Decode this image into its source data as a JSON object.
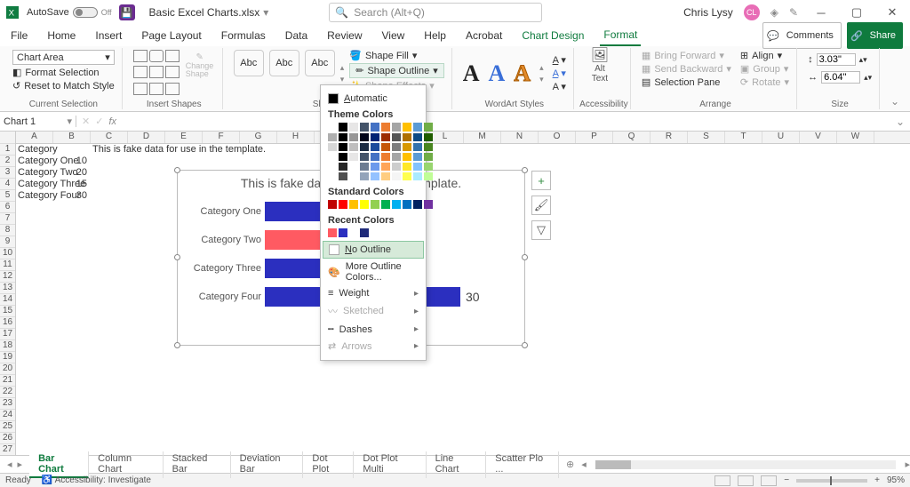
{
  "titlebar": {
    "autosave": "AutoSave",
    "autosave_state": "Off",
    "filename": "Basic Excel Charts.xlsx",
    "search_placeholder": "Search (Alt+Q)",
    "user": "Chris Lysy",
    "initials": "CL"
  },
  "menutabs": [
    "File",
    "Home",
    "Insert",
    "Page Layout",
    "Formulas",
    "Data",
    "Review",
    "View",
    "Help",
    "Acrobat",
    "Chart Design",
    "Format"
  ],
  "menu_active": "Format",
  "comments_btn": "Comments",
  "share_btn": "Share",
  "ribbon": {
    "current_selection": {
      "value": "Chart Area",
      "format_selection": "Format Selection",
      "reset": "Reset to Match Style",
      "label": "Current Selection"
    },
    "insert_shapes": {
      "change": "Change Shape",
      "label": "Insert Shapes"
    },
    "shape_styles": {
      "abc": "Abc",
      "fill": "Shape Fill",
      "outline": "Shape Outline",
      "effects": "Shape Effects",
      "label": "Shape Styles"
    },
    "wordart": {
      "label": "WordArt Styles"
    },
    "accessibility": {
      "alt": "Alt Text",
      "label": "Accessibility"
    },
    "arrange": {
      "bring": "Bring Forward",
      "send": "Send Backward",
      "selpane": "Selection Pane",
      "align": "Align",
      "group": "Group",
      "rotate": "Rotate",
      "label": "Arrange"
    },
    "size": {
      "h": "3.03\"",
      "w": "6.04\"",
      "label": "Size"
    }
  },
  "outline_dropdown": {
    "automatic": "Automatic",
    "theme": "Theme Colors",
    "standard": "Standard Colors",
    "recent": "Recent Colors",
    "no_outline": "No Outline",
    "more": "More Outline Colors...",
    "weight": "Weight",
    "sketched": "Sketched",
    "dashes": "Dashes",
    "arrows": "Arrows",
    "theme_row1": [
      "#ffffff",
      "#000000",
      "#e7e6e6",
      "#44546a",
      "#4472c4",
      "#ed7d31",
      "#a5a5a5",
      "#ffc000",
      "#5b9bd5",
      "#70ad47"
    ],
    "standard_row": [
      "#c00000",
      "#ff0000",
      "#ffc000",
      "#ffff00",
      "#92d050",
      "#00b050",
      "#00b0f0",
      "#0070c0",
      "#002060",
      "#7030a0"
    ],
    "recent_row": [
      "#ff5a62",
      "#2b2fbf",
      "#ffffff",
      "#1f2a79"
    ]
  },
  "namebox": "Chart 1",
  "columns": [
    "A",
    "B",
    "C",
    "D",
    "E",
    "F",
    "G",
    "H",
    "I",
    "J",
    "K",
    "L",
    "M",
    "N",
    "O",
    "P",
    "Q",
    "R",
    "S",
    "T",
    "U",
    "V",
    "W"
  ],
  "cells": {
    "A1": "Category",
    "C1": "This is fake data for use in the template.",
    "A2": "Category One",
    "B2": "10",
    "A3": "Category Two",
    "B3": "20",
    "A4": "Category Three",
    "B4": "15",
    "A5": "Category Four",
    "B5": "30"
  },
  "chart_data": {
    "type": "bar",
    "title": "This is fake data for use in the template.",
    "categories": [
      "Category One",
      "Category Two",
      "Category Three",
      "Category Four"
    ],
    "values": [
      10,
      20,
      15,
      30
    ],
    "highlight_index": 1,
    "data_label_index": 3,
    "data_label_value": "30",
    "xlim": [
      0,
      30
    ],
    "series_color": "#2b2fbf",
    "highlight_color": "#ff5a62"
  },
  "sheet_tabs": [
    "Bar Chart",
    "Column Chart",
    "Stacked Bar",
    "Deviation Bar",
    "Dot Plot",
    "Dot Plot Multi",
    "Line Chart",
    "Scatter Plo ..."
  ],
  "active_tab": "Bar Chart",
  "status": {
    "ready": "Ready",
    "accessibility": "Accessibility: Investigate",
    "zoom": "95%"
  }
}
